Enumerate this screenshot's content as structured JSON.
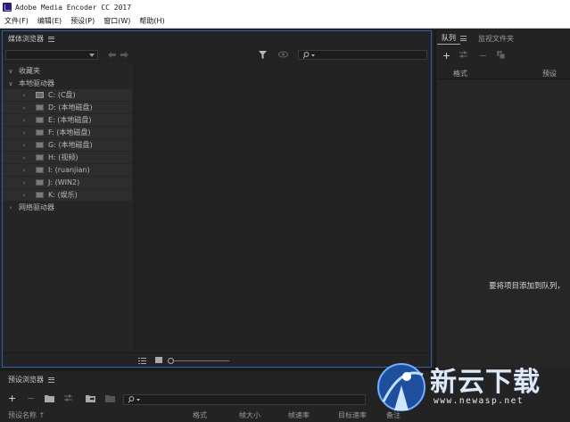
{
  "window": {
    "title": "Adobe Media Encoder CC 2017"
  },
  "menu": [
    {
      "label": "文件(F)"
    },
    {
      "label": "编辑(E)"
    },
    {
      "label": "预设(P)"
    },
    {
      "label": "窗口(W)"
    },
    {
      "label": "帮助(H)"
    }
  ],
  "media_browser": {
    "title": "媒体浏览器",
    "favorites": "收藏夹",
    "local_drives": "本地驱动器",
    "drives": [
      {
        "label": "C: (C盘)"
      },
      {
        "label": "D: (本地磁盘)"
      },
      {
        "label": "E: (本地磁盘)"
      },
      {
        "label": "F: (本地磁盘)"
      },
      {
        "label": "G: (本地磁盘)"
      },
      {
        "label": "H: (视频)"
      },
      {
        "label": "I: (ruanjian)"
      },
      {
        "label": "J: (WIN2)"
      },
      {
        "label": "K: (娱乐)"
      }
    ],
    "network_drives": "网络驱动器"
  },
  "queue": {
    "tab_queue": "队列",
    "tab_watch_folders": "监视文件夹",
    "col_format": "格式",
    "col_preset": "预设",
    "empty_hint": "要将项目添加到队列，"
  },
  "preset_browser": {
    "title": "预设浏览器",
    "columns": [
      "预设名称 ↑",
      "格式",
      "帧大小",
      "帧速率",
      "目标速率",
      "备注"
    ]
  },
  "watermark": {
    "title": "新云下载",
    "url": "www.newasp.net"
  },
  "icons": {
    "filter": "filter-icon",
    "eye": "eye-icon",
    "search": "search-icon",
    "back": "back-arrow-icon",
    "forward": "forward-arrow-icon"
  }
}
